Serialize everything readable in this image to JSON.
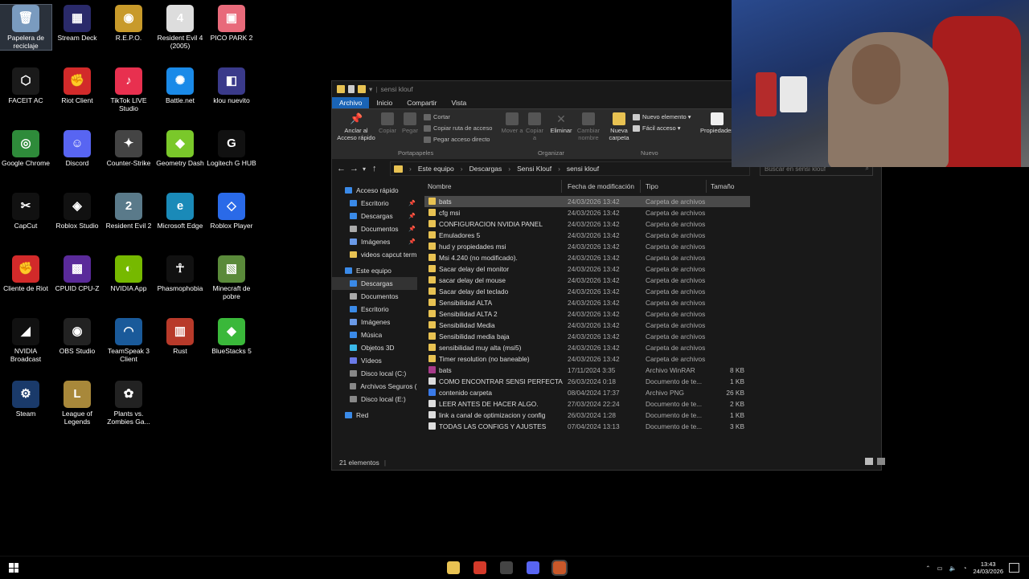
{
  "desktop": {
    "icons": [
      {
        "label": "Papelera de reciclaje",
        "icon": "recycle-bin-icon",
        "color": "#7a9bbf",
        "glyph": "🗑",
        "selected": true
      },
      {
        "label": "Stream Deck",
        "icon": "stream-deck-icon",
        "color": "#2a2a6a",
        "glyph": "▦"
      },
      {
        "label": "R.E.P.O.",
        "icon": "repo-icon",
        "color": "#c89a2a",
        "glyph": "◉"
      },
      {
        "label": "Resident Evil 4 (2005)",
        "icon": "re4-icon",
        "color": "#ddd",
        "glyph": "4"
      },
      {
        "label": "PICO PARK 2",
        "icon": "pico-park-icon",
        "color": "#e86a7a",
        "glyph": "▣"
      },
      {
        "label": "FACEIT AC",
        "icon": "faceit-icon",
        "color": "#1a1a1a",
        "glyph": "⬡"
      },
      {
        "label": "Riot Client",
        "icon": "riot-client-icon",
        "color": "#d22a2a",
        "glyph": "✊"
      },
      {
        "label": "TikTok LIVE Studio",
        "icon": "tiktok-icon",
        "color": "#e8304f",
        "glyph": "♪"
      },
      {
        "label": "Battle.net",
        "icon": "battlenet-icon",
        "color": "#1a8ae8",
        "glyph": "✺"
      },
      {
        "label": "klou nuevito",
        "icon": "klou-icon",
        "color": "#3a3a8a",
        "glyph": "◧"
      },
      {
        "label": "Google Chrome",
        "icon": "chrome-icon",
        "color": "#2e8b3a",
        "glyph": "◎"
      },
      {
        "label": "Discord",
        "icon": "discord-icon",
        "color": "#5865f2",
        "glyph": "☺"
      },
      {
        "label": "Counter-Strike",
        "icon": "counter-strike-icon",
        "color": "#444",
        "glyph": "✦"
      },
      {
        "label": "Geometry Dash",
        "icon": "geometry-dash-icon",
        "color": "#7ac82a",
        "glyph": "◆"
      },
      {
        "label": "Logitech G HUB",
        "icon": "logitech-icon",
        "color": "#111",
        "glyph": "G"
      },
      {
        "label": "CapCut",
        "icon": "capcut-icon",
        "color": "#111",
        "glyph": "✂"
      },
      {
        "label": "Roblox Studio",
        "icon": "roblox-studio-icon",
        "color": "#111",
        "glyph": "◈"
      },
      {
        "label": "Resident Evil 2",
        "icon": "re2-icon",
        "color": "#5a7a8a",
        "glyph": "2"
      },
      {
        "label": "Microsoft Edge",
        "icon": "edge-icon",
        "color": "#1a8ab8",
        "glyph": "e"
      },
      {
        "label": "Roblox Player",
        "icon": "roblox-icon",
        "color": "#2a6ae8",
        "glyph": "◇"
      },
      {
        "label": "Cliente de Riot",
        "icon": "riot-icon",
        "color": "#d22a2a",
        "glyph": "✊"
      },
      {
        "label": "CPUID CPU-Z",
        "icon": "cpuz-icon",
        "color": "#5a2a9a",
        "glyph": "▩"
      },
      {
        "label": "NVIDIA App",
        "icon": "nvidia-app-icon",
        "color": "#76b900",
        "glyph": "◐"
      },
      {
        "label": "Phasmophobia",
        "icon": "phasmophobia-icon",
        "color": "#111",
        "glyph": "☥"
      },
      {
        "label": "Minecraft de pobre",
        "icon": "minecraft-icon",
        "color": "#5a8a3a",
        "glyph": "▧"
      },
      {
        "label": "NVIDIA Broadcast",
        "icon": "nvidia-broadcast-icon",
        "color": "#111",
        "glyph": "◢"
      },
      {
        "label": "OBS Studio",
        "icon": "obs-icon",
        "color": "#222",
        "glyph": "◉"
      },
      {
        "label": "TeamSpeak 3 Client",
        "icon": "teamspeak-icon",
        "color": "#1a5a9a",
        "glyph": "◠"
      },
      {
        "label": "Rust",
        "icon": "rust-icon",
        "color": "#b83a2a",
        "glyph": "▥"
      },
      {
        "label": "BlueStacks 5",
        "icon": "bluestacks-icon",
        "color": "#3ab83a",
        "glyph": "◆"
      },
      {
        "label": "Steam",
        "icon": "steam-icon",
        "color": "#1a3a6a",
        "glyph": "⚙"
      },
      {
        "label": "League of Legends",
        "icon": "lol-icon",
        "color": "#a8883a",
        "glyph": "L"
      },
      {
        "label": "Plants vs. Zombies Ga...",
        "icon": "pvz-icon",
        "color": "#222",
        "glyph": "✿"
      }
    ]
  },
  "explorer": {
    "title": "sensi klouf",
    "tabs": [
      "Archivo",
      "Inicio",
      "Compartir",
      "Vista"
    ],
    "ribbon": {
      "pin_label": "Anclar al Acceso rápido",
      "copy_label": "Copiar",
      "paste_label": "Pegar",
      "cut_label": "Cortar",
      "copy_path_label": "Copiar ruta de acceso",
      "paste_shortcut_label": "Pegar acceso directo",
      "clipboard_group": "Portapapeles",
      "move_label": "Mover a",
      "copy_to_label": "Copiar a",
      "delete_label": "Eliminar",
      "rename_label": "Cambiar nombre",
      "organize_group": "Organizar",
      "new_folder_label": "Nueva carpeta",
      "new_item_label": "Nuevo elemento",
      "easy_access_label": "Fácil acceso",
      "new_group": "Nuevo",
      "properties_label": "Propiedades"
    },
    "breadcrumb": [
      "Este equipo",
      "Descargas",
      "Sensi Klouf",
      "sensi klouf"
    ],
    "search_placeholder": "Buscar en sensi klouf",
    "nav": [
      {
        "label": "Acceso rápido",
        "icon": "star-icon",
        "color": "#3a8ae8",
        "indent": 0,
        "pin": false
      },
      {
        "label": "Escritorio",
        "icon": "desktop-icon",
        "color": "#3a8ae8",
        "indent": 1,
        "pin": true
      },
      {
        "label": "Descargas",
        "icon": "download-icon",
        "color": "#3a8ae8",
        "indent": 1,
        "pin": true
      },
      {
        "label": "Documentos",
        "icon": "documents-icon",
        "color": "#aaa",
        "indent": 1,
        "pin": true
      },
      {
        "label": "Imágenes",
        "icon": "images-icon",
        "color": "#6a9ae8",
        "indent": 1,
        "pin": true
      },
      {
        "label": "videos capcut termi",
        "icon": "folder-icon",
        "color": "#e8c252",
        "indent": 1,
        "pin": false
      },
      {
        "label": "Este equipo",
        "icon": "pc-icon",
        "color": "#3a8ae8",
        "indent": 0,
        "pin": false
      },
      {
        "label": "Descargas",
        "icon": "download-icon",
        "color": "#3a8ae8",
        "indent": 1,
        "pin": false,
        "selected": true
      },
      {
        "label": "Documentos",
        "icon": "documents-icon",
        "color": "#aaa",
        "indent": 1,
        "pin": false
      },
      {
        "label": "Escritorio",
        "icon": "desktop-icon",
        "color": "#3a8ae8",
        "indent": 1,
        "pin": false
      },
      {
        "label": "Imágenes",
        "icon": "images-icon",
        "color": "#6a9ae8",
        "indent": 1,
        "pin": false
      },
      {
        "label": "Música",
        "icon": "music-icon",
        "color": "#3a8ae8",
        "indent": 1,
        "pin": false
      },
      {
        "label": "Objetos 3D",
        "icon": "objects-3d-icon",
        "color": "#3ab8e8",
        "indent": 1,
        "pin": false
      },
      {
        "label": "Vídeos",
        "icon": "videos-icon",
        "color": "#6a7ae8",
        "indent": 1,
        "pin": false
      },
      {
        "label": "Disco local (C:)",
        "icon": "drive-icon",
        "color": "#888",
        "indent": 1,
        "pin": false
      },
      {
        "label": "Archivos Seguros (D",
        "icon": "drive-icon",
        "color": "#888",
        "indent": 1,
        "pin": false
      },
      {
        "label": "Disco local (E:)",
        "icon": "drive-icon",
        "color": "#888",
        "indent": 1,
        "pin": false
      },
      {
        "label": "Red",
        "icon": "network-icon",
        "color": "#3a8ae8",
        "indent": 0,
        "pin": false
      }
    ],
    "columns": {
      "name": "Nombre",
      "date": "Fecha de modificación",
      "type": "Tipo",
      "size": "Tamaño"
    },
    "files": [
      {
        "name": "bats",
        "date": "24/03/2026 13:42",
        "type": "Carpeta de archivos",
        "size": "",
        "kind": "folder",
        "highlight": true
      },
      {
        "name": "cfg msi",
        "date": "24/03/2026 13:42",
        "type": "Carpeta de archivos",
        "size": "",
        "kind": "folder"
      },
      {
        "name": "CONFIGURACION NVIDIA PANEL",
        "date": "24/03/2026 13:42",
        "type": "Carpeta de archivos",
        "size": "",
        "kind": "folder"
      },
      {
        "name": "Emuladores 5",
        "date": "24/03/2026 13:42",
        "type": "Carpeta de archivos",
        "size": "",
        "kind": "folder"
      },
      {
        "name": "hud y propiedades msi",
        "date": "24/03/2026 13:42",
        "type": "Carpeta de archivos",
        "size": "",
        "kind": "folder"
      },
      {
        "name": "Msi 4.240 (no modificado).",
        "date": "24/03/2026 13:42",
        "type": "Carpeta de archivos",
        "size": "",
        "kind": "folder"
      },
      {
        "name": "Sacar delay del monitor",
        "date": "24/03/2026 13:42",
        "type": "Carpeta de archivos",
        "size": "",
        "kind": "folder"
      },
      {
        "name": "sacar delay del mouse",
        "date": "24/03/2026 13:42",
        "type": "Carpeta de archivos",
        "size": "",
        "kind": "folder"
      },
      {
        "name": "Sacar delay del teclado",
        "date": "24/03/2026 13:42",
        "type": "Carpeta de archivos",
        "size": "",
        "kind": "folder"
      },
      {
        "name": "Sensibilidad ALTA",
        "date": "24/03/2026 13:42",
        "type": "Carpeta de archivos",
        "size": "",
        "kind": "folder"
      },
      {
        "name": "Sensibilidad ALTA 2",
        "date": "24/03/2026 13:42",
        "type": "Carpeta de archivos",
        "size": "",
        "kind": "folder"
      },
      {
        "name": "Sensibilidad Media",
        "date": "24/03/2026 13:42",
        "type": "Carpeta de archivos",
        "size": "",
        "kind": "folder"
      },
      {
        "name": "Sensibilidad media baja",
        "date": "24/03/2026 13:42",
        "type": "Carpeta de archivos",
        "size": "",
        "kind": "folder"
      },
      {
        "name": "sensibilidad muy alta (msi5)",
        "date": "24/03/2026 13:42",
        "type": "Carpeta de archivos",
        "size": "",
        "kind": "folder"
      },
      {
        "name": "Timer resolution (no baneable)",
        "date": "24/03/2026 13:42",
        "type": "Carpeta de archivos",
        "size": "",
        "kind": "folder"
      },
      {
        "name": "bats",
        "date": "17/11/2024 3:35",
        "type": "Archivo WinRAR",
        "size": "8 KB",
        "kind": "rar"
      },
      {
        "name": "COMO ENCONTRAR SENSI PERFECTA",
        "date": "26/03/2024 0:18",
        "type": "Documento de te...",
        "size": "1 KB",
        "kind": "doc"
      },
      {
        "name": "contenido carpeta",
        "date": "08/04/2024 17:37",
        "type": "Archivo PNG",
        "size": "26 KB",
        "kind": "png"
      },
      {
        "name": "LEER ANTES DE HACER ALGO.",
        "date": "27/03/2024 22:24",
        "type": "Documento de te...",
        "size": "2 KB",
        "kind": "doc"
      },
      {
        "name": "link a canal de optimizacion y config",
        "date": "26/03/2024 1:28",
        "type": "Documento de te...",
        "size": "1 KB",
        "kind": "doc"
      },
      {
        "name": "TODAS LAS CONFIGS Y AJUSTES",
        "date": "07/04/2024 13:13",
        "type": "Documento de te...",
        "size": "3 KB",
        "kind": "doc"
      }
    ],
    "status": "21 elementos"
  },
  "taskbar": {
    "apps": [
      {
        "name": "file-explorer-icon",
        "color": "#e8c252"
      },
      {
        "name": "chrome-icon",
        "color": "#d43a2a"
      },
      {
        "name": "obs-icon",
        "color": "#444"
      },
      {
        "name": "discord-icon",
        "color": "#5865f2"
      },
      {
        "name": "terminal-icon",
        "color": "#c8582a",
        "active": true
      }
    ],
    "time": "13:43",
    "date": "24/03/2026"
  }
}
